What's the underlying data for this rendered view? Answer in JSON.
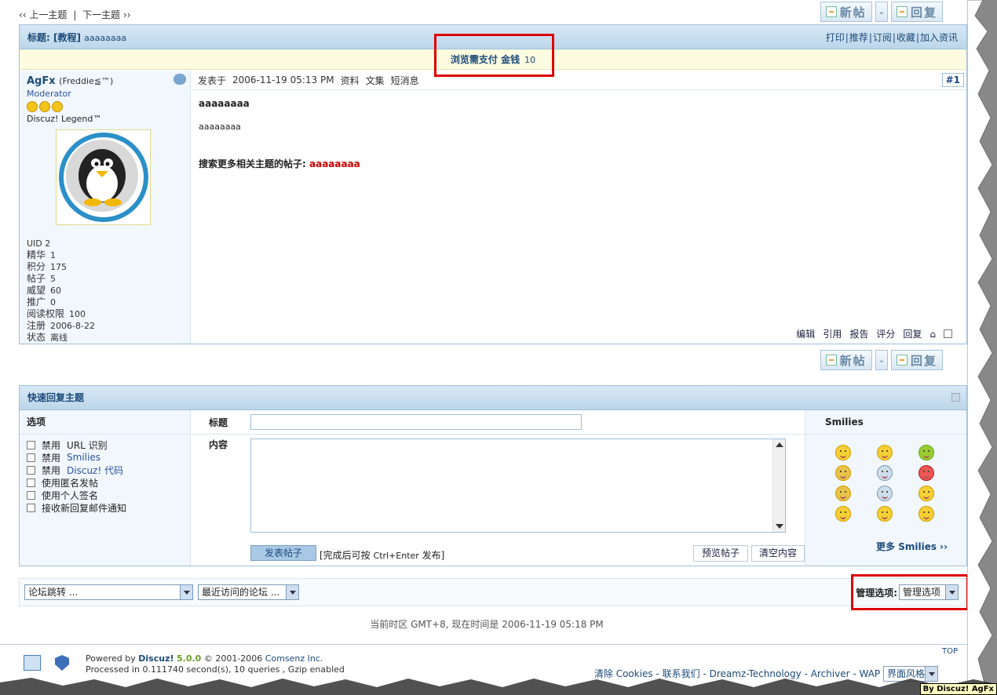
{
  "nav": {
    "prev": "‹‹ 上一主题",
    "next": "下一主题 ››"
  },
  "buttons": {
    "new_post": "新帖",
    "reply": "回复"
  },
  "thread": {
    "title_prefix": "标题: [教程]",
    "title": "aaaaaaaa",
    "actions": [
      "打印",
      "推荐",
      "订阅",
      "收藏",
      "加入资讯"
    ],
    "pay_label": "浏览需支付",
    "pay_currency": "金钱",
    "pay_amount": "10"
  },
  "author": {
    "name": "AgFx",
    "nick": "(Freddie≦™)",
    "role": "Moderator",
    "title": "Discuz! Legend™",
    "uid": "UID 2",
    "stats": [
      {
        "k": "精华",
        "v": "1"
      },
      {
        "k": "积分",
        "v": "175"
      },
      {
        "k": "帖子",
        "v": "5"
      },
      {
        "k": "威望",
        "v": "60"
      },
      {
        "k": "推广",
        "v": "0"
      },
      {
        "k": "阅读权限",
        "v": "100"
      },
      {
        "k": "注册",
        "v": "2006-8-22"
      },
      {
        "k": "状态",
        "v": "离线"
      }
    ]
  },
  "post": {
    "posted_label": "发表于",
    "time": "2006-11-19 05:13 PM",
    "links": [
      "资料",
      "文集",
      "短消息"
    ],
    "floor": "#1",
    "title": "aaaaaaaa",
    "text": "aaaaaaaa",
    "related_label": "搜索更多相关主题的帖子:",
    "related_keyword": "aaaaaaaa",
    "actions": [
      "编辑",
      "引用",
      "报告",
      "评分",
      "回复"
    ]
  },
  "quick_reply": {
    "title": "快速回复主题",
    "options_label": "选项",
    "options": [
      {
        "a": "禁用",
        "b": "URL 识别"
      },
      {
        "a": "禁用",
        "b": "Smilies"
      },
      {
        "a": "禁用",
        "b": "Discuz! 代码"
      },
      {
        "a": "使用匿名发帖"
      },
      {
        "a": "使用个人签名"
      },
      {
        "a": "接收新回复邮件通知"
      }
    ],
    "subject_label": "标题",
    "content_label": "内容",
    "submit": "发表帖子",
    "hint_a": "[完成后可按",
    "hint_key": "Ctrl+Enter",
    "hint_b": "发布]",
    "preview": "预览帖子",
    "clear": "清空内容",
    "smilies_label": "Smilies",
    "more_a": "更多",
    "more_b": "Smilies ››"
  },
  "bottom": {
    "forum_jump": "论坛跳转 ...",
    "recent_forums": "最近访问的论坛 ...",
    "admin_label": "管理选项:",
    "admin_value": "管理选项",
    "tz_a": "当前时区",
    "tz_b": "GMT+8, 现在时间是",
    "tz_time": "2006-11-19 05:18 PM"
  },
  "footer": {
    "powered": "Powered by",
    "brand": "Discuz!",
    "version": "5.0.0",
    "copyright": "© 2001-2006",
    "company": "Comsenz Inc.",
    "processed": "Processed in 0.111740 second(s), 10 queries , Gzip enabled",
    "top": "TOP",
    "links": [
      "清除",
      "Cookies",
      "联系我们",
      "Dreamz-Technology",
      "Archiver",
      "WAP"
    ],
    "style": "界面风格"
  },
  "watermark": "By Discuz! AgFx"
}
